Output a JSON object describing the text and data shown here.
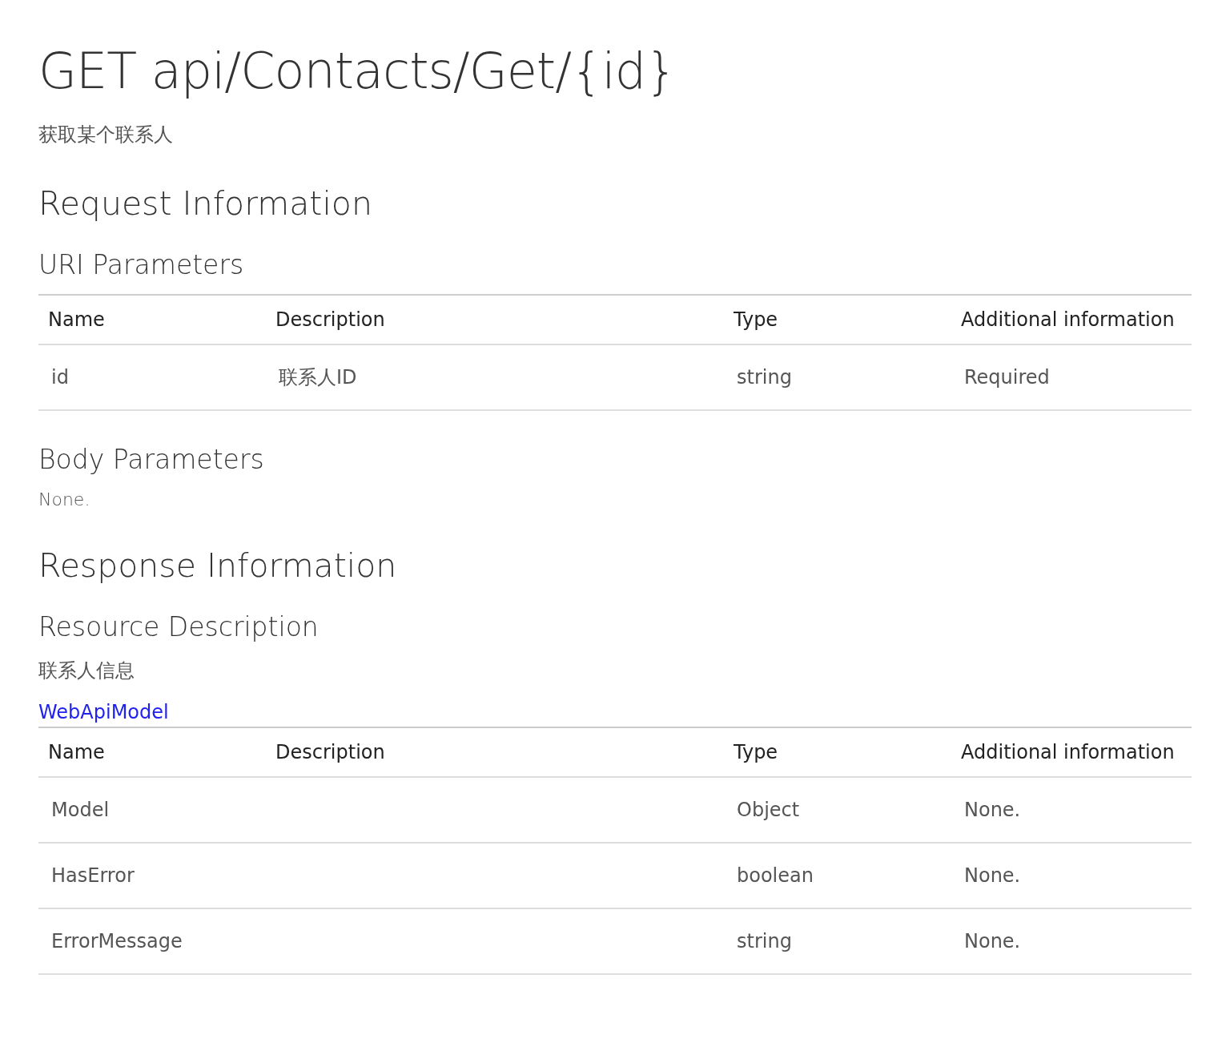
{
  "title": "GET api/Contacts/Get/{id}",
  "description": "获取某个联系人",
  "request": {
    "heading": "Request Information",
    "uri_parameters": {
      "heading": "URI Parameters",
      "columns": [
        "Name",
        "Description",
        "Type",
        "Additional information"
      ],
      "rows": [
        [
          "id",
          "联系人ID",
          "string",
          "Required"
        ]
      ]
    },
    "body_parameters": {
      "heading": "Body Parameters",
      "text": "None."
    }
  },
  "response": {
    "heading": "Response Information",
    "resource_description": {
      "heading": "Resource Description",
      "text": "联系人信息",
      "link": "WebApiModel",
      "columns": [
        "Name",
        "Description",
        "Type",
        "Additional information"
      ],
      "rows": [
        [
          "Model",
          "",
          "Object",
          "None."
        ],
        [
          "HasError",
          "",
          "boolean",
          "None."
        ],
        [
          "ErrorMessage",
          "",
          "string",
          "None."
        ]
      ]
    }
  }
}
